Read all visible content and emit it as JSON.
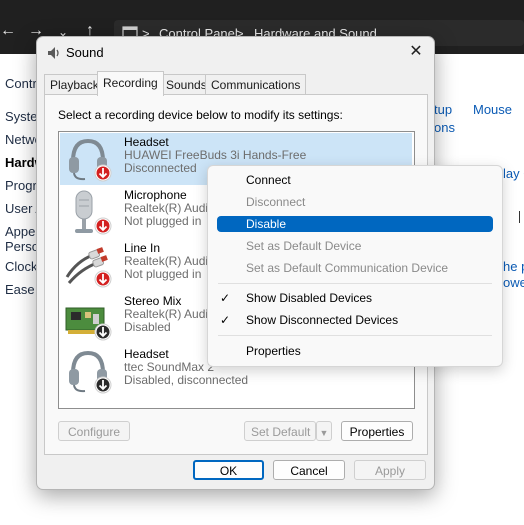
{
  "colors": {
    "accent": "#0067c0",
    "selection": "#cce4f7",
    "titlebar_dark": "#202020"
  },
  "background_window": {
    "nav_icons": [
      "back-arrow-icon",
      "forward-arrow-icon",
      "chevron-down-icon",
      "up-arrow-icon"
    ],
    "breadcrumb": {
      "separator": ">",
      "items": [
        "Control Panel",
        "Hardware and Sound"
      ]
    },
    "left_nav": [
      "Contr",
      "Syster",
      "Netwo",
      "Hardw",
      "Progra",
      "User A",
      "Appea",
      "Person",
      "Clock",
      "Ease o"
    ],
    "right_links": [
      "tup",
      "Mouse",
      "ons",
      "lay C",
      "he po",
      "owe"
    ]
  },
  "dialog": {
    "title": "Sound",
    "close_icon": "close-icon",
    "tabs": [
      "Playback",
      "Recording",
      "Sounds",
      "Communications"
    ],
    "active_tab": "Recording",
    "instruction": "Select a recording device below to modify its settings:",
    "devices": [
      {
        "name": "Headset",
        "sub": "HUAWEI FreeBuds 3i Hands-Free",
        "status": "Disconnected",
        "icon": "headset-icon",
        "badge": "red-down-arrow-icon"
      },
      {
        "name": "Microphone",
        "sub": "Realtek(R) Audio",
        "status": "Not plugged in",
        "icon": "microphone-icon",
        "badge": "red-down-arrow-icon"
      },
      {
        "name": "Line In",
        "sub": "Realtek(R) Audio",
        "status": "Not plugged in",
        "icon": "rca-cable-icon",
        "badge": "red-down-arrow-icon"
      },
      {
        "name": "Stereo Mix",
        "sub": "Realtek(R) Audio",
        "status": "Disabled",
        "icon": "sound-card-icon",
        "badge": "black-down-arrow-icon"
      },
      {
        "name": "Headset",
        "sub": "ttec SoundMax 2",
        "status": "Disabled, disconnected",
        "icon": "headset-icon",
        "badge": "black-down-arrow-icon"
      }
    ],
    "buttons": {
      "configure": "Configure",
      "set_default": "Set Default",
      "properties": "Properties",
      "ok": "OK",
      "cancel": "Cancel",
      "apply": "Apply"
    }
  },
  "context_menu": {
    "items": [
      {
        "label": "Connect",
        "enabled": true
      },
      {
        "label": "Disconnect",
        "enabled": false
      },
      {
        "label": "Disable",
        "enabled": true,
        "highlighted": true
      },
      {
        "label": "Set as Default Device",
        "enabled": false
      },
      {
        "label": "Set as Default Communication Device",
        "enabled": false
      },
      {
        "label": "Show Disabled Devices",
        "checked": true
      },
      {
        "label": "Show Disconnected Devices",
        "checked": true
      },
      {
        "label": "Properties",
        "enabled": true
      }
    ],
    "check_glyph": "✓"
  }
}
